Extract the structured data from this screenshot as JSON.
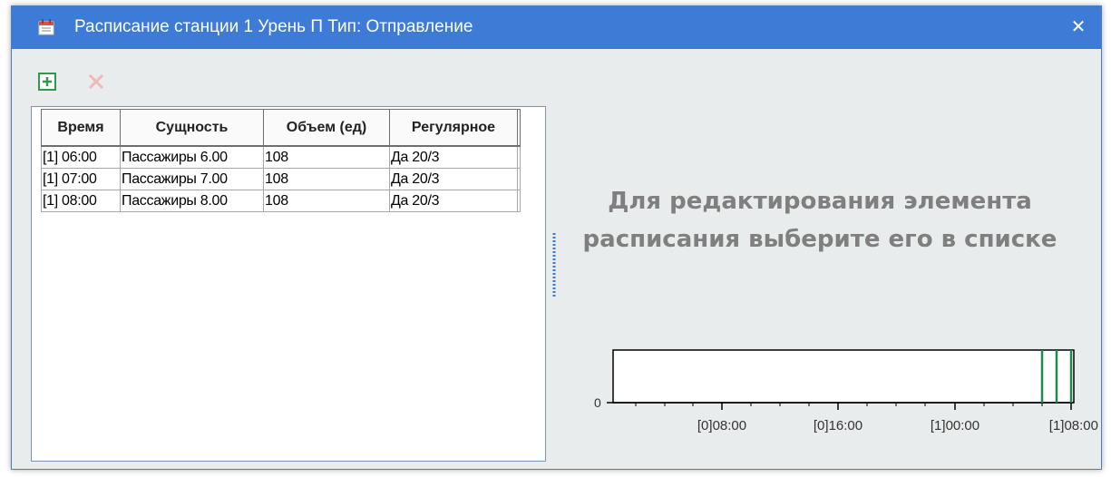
{
  "window": {
    "title": "Расписание станции 1 Урень П Тип: Отправление",
    "close_glyph": "✕",
    "title_icon": "calendar-icon"
  },
  "toolbar": {
    "add_icon": "plus-box-icon",
    "delete_icon": "delete-x-icon",
    "add_color": "#2e9a4a",
    "delete_color": "#f2b8b4"
  },
  "grid": {
    "columns": [
      "Время",
      "Сущность",
      "Объем (ед)",
      "Регулярное"
    ],
    "rows": [
      [
        "[1] 06:00",
        "Пассажиры 6.00",
        "108",
        "Да 20/3"
      ],
      [
        "[1] 07:00",
        "Пассажиры 7.00",
        "108",
        "Да 20/3"
      ],
      [
        "[1] 08:00",
        "Пассажиры 8.00",
        "108",
        "Да 20/3"
      ]
    ]
  },
  "hint": {
    "line1": "Для редактирования элемента",
    "line2": "расписания выберите его в списке"
  },
  "timeline": {
    "y_label": "0",
    "tick_labels": [
      "[0]08:00",
      "[0]16:00",
      "[1]00:00",
      "[1]08:00"
    ],
    "marker_color": "#1f8a4c"
  }
}
